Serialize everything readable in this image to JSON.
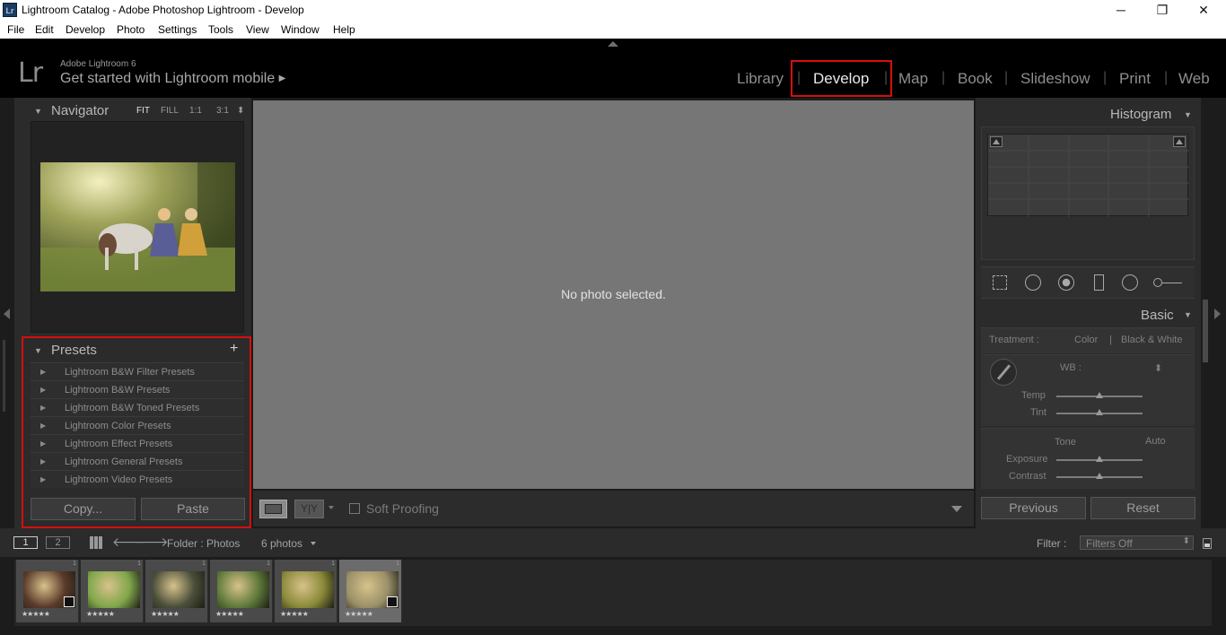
{
  "window": {
    "title": "Lightroom Catalog - Adobe Photoshop Lightroom - Develop",
    "app_icon": "Lr",
    "controls": {
      "minimize": "─",
      "maximize": "❐",
      "close": "✕"
    }
  },
  "menu": [
    "File",
    "Edit",
    "Develop",
    "Photo",
    "Settings",
    "Tools",
    "View",
    "Window",
    "Help"
  ],
  "identity": {
    "logo": "Lr",
    "version": "Adobe Lightroom 6",
    "mobile_prompt": "Get started with Lightroom mobile",
    "mobile_arrow": "▶"
  },
  "modules": {
    "items": [
      "Library",
      "Develop",
      "Map",
      "Book",
      "Slideshow",
      "Print",
      "Web"
    ],
    "active": "Develop",
    "separator": "|"
  },
  "navigator": {
    "title": "Navigator",
    "options": [
      "FIT",
      "FILL",
      "1:1",
      "3:1"
    ],
    "arrows": "⬍"
  },
  "presets": {
    "title": "Presets",
    "add": "+",
    "items": [
      "Lightroom B&W Filter Presets",
      "Lightroom B&W Presets",
      "Lightroom B&W Toned Presets",
      "Lightroom Color Presets",
      "Lightroom Effect Presets",
      "Lightroom General Presets",
      "Lightroom Video Presets"
    ],
    "expander": "▶"
  },
  "left_buttons": {
    "copy": "Copy...",
    "paste": "Paste"
  },
  "center": {
    "message": "No photo selected."
  },
  "toolbar": {
    "soft_proofing": "Soft Proofing",
    "yy": "Y|Y"
  },
  "histogram": {
    "title": "Histogram"
  },
  "basic": {
    "title": "Basic",
    "treatment_label": "Treatment :",
    "treatment_color": "Color",
    "treatment_sep": "|",
    "treatment_bw": "Black & White",
    "wb_label": "WB :",
    "wb_arrows": "⬍",
    "temp": "Temp",
    "tint": "Tint",
    "tone": "Tone",
    "auto": "Auto",
    "exposure": "Exposure",
    "contrast": "Contrast"
  },
  "right_buttons": {
    "previous": "Previous",
    "reset": "Reset"
  },
  "filmstrip_nav": {
    "view1": "1",
    "view2": "2",
    "folder": "Folder : Photos",
    "count": "6 photos",
    "filter_label": "Filter :",
    "filter_value": "Filters Off"
  },
  "filmstrip": {
    "rating": "★★★★★",
    "items": [
      {
        "n": "1",
        "color": "#5a3a2a"
      },
      {
        "n": "1",
        "color": "#7fa64a"
      },
      {
        "n": "1",
        "color": "#4a4f3a"
      },
      {
        "n": "1",
        "color": "#5f7a3a"
      },
      {
        "n": "1",
        "color": "#8a8a3a"
      },
      {
        "n": "1",
        "color": "#9a9068"
      }
    ],
    "selected_index": 5
  },
  "colors": {
    "highlight": "#d60e0e",
    "center": "#767676",
    "panel": "#2b2b2b"
  }
}
